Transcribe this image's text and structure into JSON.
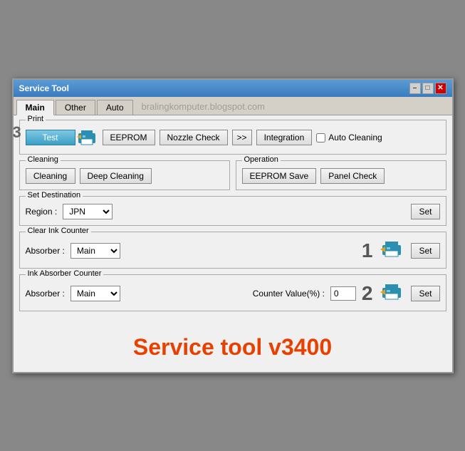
{
  "window": {
    "title": "Service Tool",
    "controls": {
      "minimize": "–",
      "maximize": "□",
      "close": "✕"
    }
  },
  "tabs": [
    {
      "label": "Main",
      "active": true
    },
    {
      "label": "Other",
      "active": false
    },
    {
      "label": "Auto",
      "active": false
    }
  ],
  "watermark": "bralingkomputer.blogspot.com",
  "sections": {
    "print": {
      "label": "Print",
      "buttons": {
        "test": "Test",
        "eeprom": "EEPROM",
        "nozzle_check": "Nozzle Check",
        "arrow": ">>",
        "integration": "Integration"
      },
      "auto_cleaning": "Auto Cleaning"
    },
    "cleaning": {
      "label": "Cleaning",
      "buttons": {
        "cleaning": "Cleaning",
        "deep_cleaning": "Deep Cleaning"
      }
    },
    "operation": {
      "label": "Operation",
      "buttons": {
        "eeprom_save": "EEPROM Save",
        "panel_check": "Panel Check"
      }
    },
    "set_destination": {
      "label": "Set Destination",
      "region_label": "Region :",
      "region_value": "JPN",
      "set_btn": "Set"
    },
    "clear_ink": {
      "label": "Clear Ink Counter",
      "absorber_label": "Absorber :",
      "absorber_value": "Main",
      "set_btn": "Set",
      "badge": "1"
    },
    "ink_absorber": {
      "label": "Ink Absorber Counter",
      "absorber_label": "Absorber :",
      "absorber_value": "Main",
      "counter_label": "Counter Value(%) :",
      "counter_value": "0",
      "set_btn": "Set",
      "badge": "2"
    }
  },
  "service_tool_title": "Service tool v3400",
  "badge3_label": "3"
}
